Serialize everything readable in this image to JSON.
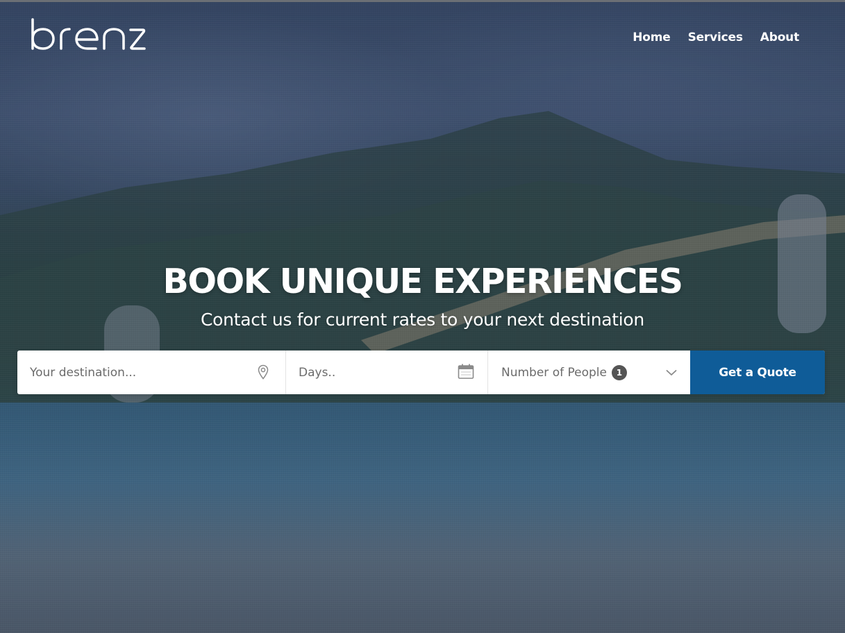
{
  "brand": {
    "logo_text": "brenz"
  },
  "nav": {
    "items": [
      "Home",
      "Services",
      "About"
    ]
  },
  "hero": {
    "title": "BOOK UNIQUE EXPERIENCES",
    "subtitle": "Contact us for current rates to your next destination"
  },
  "search": {
    "destination_placeholder": "Your destination...",
    "days_placeholder": "Days..",
    "people_label": "Number of People",
    "people_count": "1",
    "submit_label": "Get a Quote"
  },
  "icons": {
    "destination": "map-pin-icon",
    "days": "calendar-icon",
    "people": "chevron-down-icon"
  },
  "colors": {
    "accent": "#0f5c98",
    "text_light": "#ffffff",
    "placeholder": "#6b6b6b"
  }
}
